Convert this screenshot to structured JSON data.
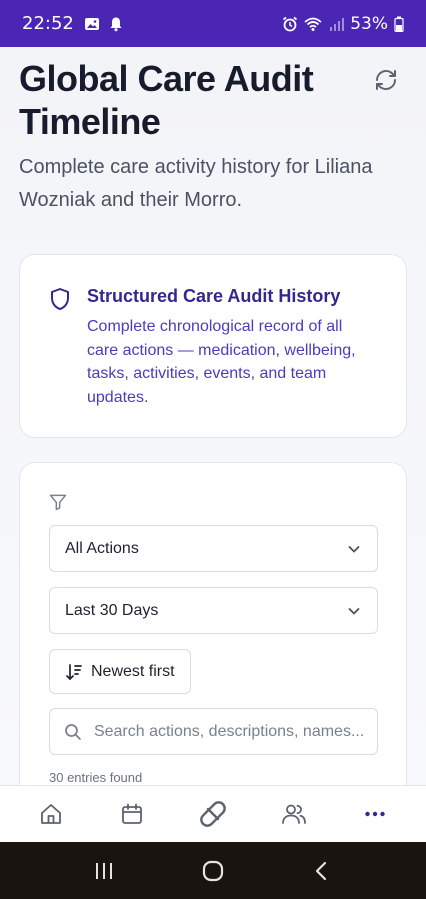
{
  "status_bar": {
    "time": "22:52",
    "battery": "53%",
    "icons": [
      "image-icon",
      "notification-bell-icon",
      "alarm-icon",
      "wifi-icon",
      "signal-icon",
      "battery-icon"
    ]
  },
  "header": {
    "title": "Global Care Audit Timeline",
    "subtitle": "Complete care activity history for Liliana Wozniak and their Morro.",
    "refresh_icon": "refresh-icon"
  },
  "audit_card": {
    "icon": "shield-icon",
    "title": "Structured Care Audit History",
    "description": "Complete chronological record of all care actions — medication, wellbeing, tasks, activities, events, and team updates."
  },
  "filters": {
    "icon": "filter-icon",
    "action_filter": "All Actions",
    "date_filter": "Last 30 Days",
    "sort_label": "Newest first",
    "search_placeholder": "Search actions, descriptions, names...",
    "entries_found": "30 entries found"
  },
  "bottom_nav": {
    "items": [
      "home-icon",
      "calendar-icon",
      "pill-icon",
      "users-icon",
      "more-icon"
    ]
  },
  "android_nav": [
    "recents-button",
    "home-button",
    "back-button"
  ],
  "colors": {
    "status_bar": "#4b25b4",
    "accent": "#32288e",
    "accent_text": "#4a3cbf",
    "nav_active": "#32288e"
  }
}
